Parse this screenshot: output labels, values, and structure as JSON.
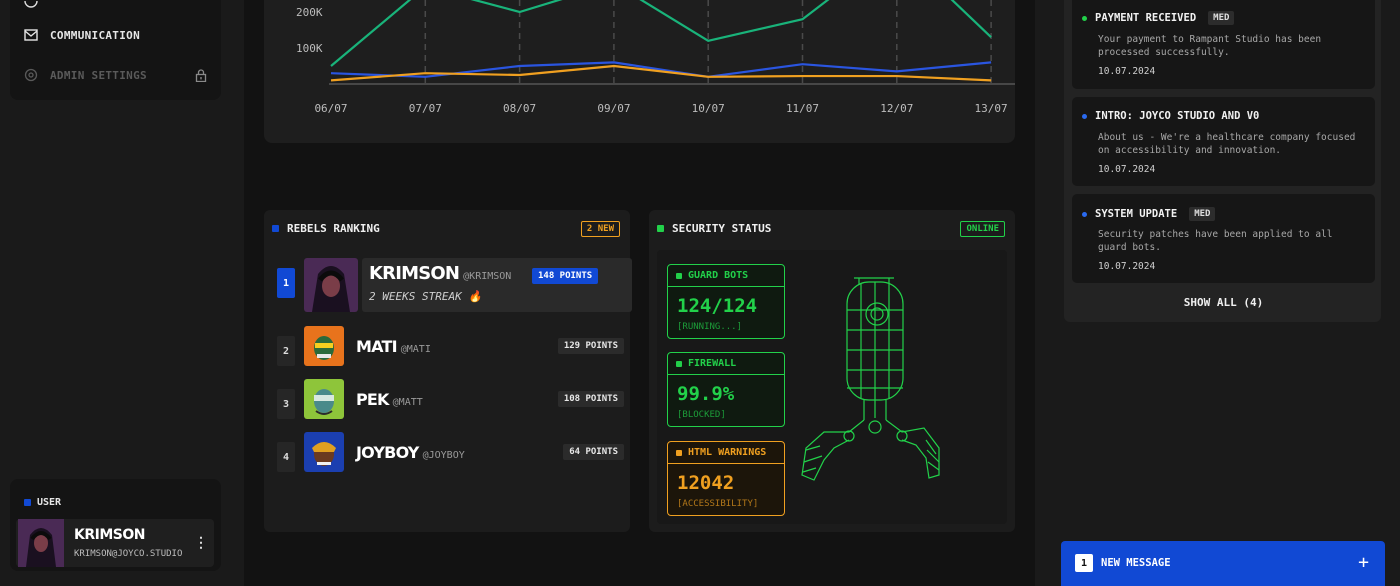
{
  "sidebar": {
    "nav": [
      {
        "label": "COMMUNICATION",
        "icon": "mail-icon"
      },
      {
        "label": "ADMIN SETTINGS",
        "icon": "settings-icon",
        "locked": true
      }
    ],
    "user": {
      "section_label": "USER",
      "name": "KRIMSON",
      "email": "KRIMSON@JOYCO.STUDIO"
    }
  },
  "chart_data": {
    "type": "line",
    "categories": [
      "06/07",
      "07/07",
      "08/07",
      "09/07",
      "10/07",
      "11/07",
      "12/07",
      "13/07"
    ],
    "y_ticks": [
      "100K",
      "200K"
    ],
    "ylim": [
      0,
      240000
    ],
    "grid": "vertical dashed",
    "series": [
      {
        "color": "#19b37a",
        "values": [
          50000,
          270000,
          200000,
          280000,
          120000,
          180000,
          380000,
          130000
        ]
      },
      {
        "color": "#2a55e0",
        "values": [
          30000,
          20000,
          50000,
          60000,
          20000,
          55000,
          35000,
          60000
        ]
      },
      {
        "color": "#f0a020",
        "values": [
          10000,
          30000,
          25000,
          50000,
          20000,
          22000,
          22000,
          10000
        ]
      }
    ]
  },
  "ranking": {
    "title": "REBELS RANKING",
    "badge": "2 NEW",
    "rows": [
      {
        "rank": "1",
        "name": "KRIMSON",
        "handle": "@KRIMSON",
        "points": "148 POINTS",
        "sub": "2 WEEKS STREAK 🔥"
      },
      {
        "rank": "2",
        "name": "MATI",
        "handle": "@MATI",
        "points": "129 POINTS"
      },
      {
        "rank": "3",
        "name": "PEK",
        "handle": "@MATT",
        "points": "108 POINTS"
      },
      {
        "rank": "4",
        "name": "JOYBOY",
        "handle": "@JOYBOY",
        "points": "64 POINTS"
      }
    ]
  },
  "security": {
    "title": "SECURITY STATUS",
    "badge": "ONLINE",
    "stats": [
      {
        "label": "GUARD BOTS",
        "value": "124/124",
        "sub": "[RUNNING...]",
        "color": "#22d14a"
      },
      {
        "label": "FIREWALL",
        "value": "99.9%",
        "sub": "[BLOCKED]",
        "color": "#22d14a"
      },
      {
        "label": "HTML WARNINGS",
        "value": "12042",
        "sub": "[ACCESSIBILITY]",
        "color": "#f0a020"
      }
    ]
  },
  "notifications": {
    "items": [
      {
        "title": "PAYMENT RECEIVED",
        "tag": "MED",
        "dot": "#22d14a",
        "body": "Your payment to Rampant Studio has been processed successfully.",
        "date": "10.07.2024"
      },
      {
        "title": "INTRO: JOYCO STUDIO AND V0",
        "tag": "",
        "dot": "#2a6af0",
        "body": "About us - We're a healthcare company focused on accessibility and innovation.",
        "date": "10.07.2024"
      },
      {
        "title": "SYSTEM UPDATE",
        "tag": "MED",
        "dot": "#2a6af0",
        "body": "Security patches have been applied to all guard bots.",
        "date": "10.07.2024"
      }
    ],
    "show_all": "SHOW ALL (4)"
  },
  "message_bar": {
    "count": "1",
    "label": "NEW MESSAGE",
    "plus": "+"
  }
}
